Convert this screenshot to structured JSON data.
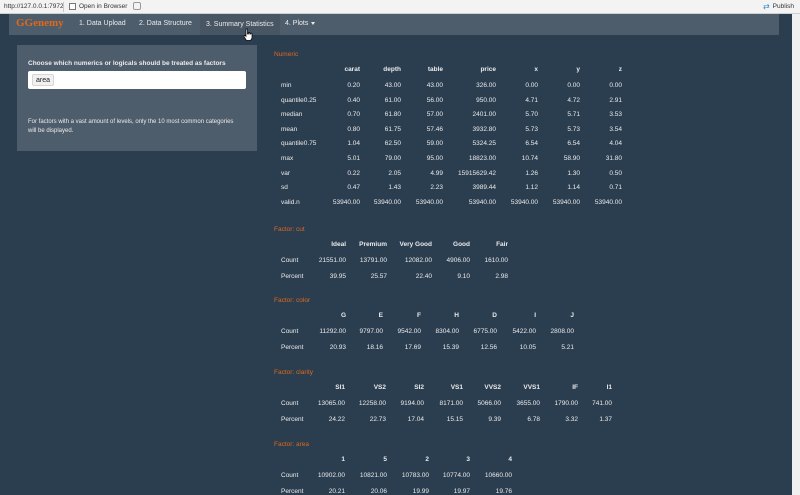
{
  "browser": {
    "url": "http://127.0.0.1:7972",
    "open_in_browser": "Open in Browser",
    "publish": "Publish"
  },
  "nav": {
    "brand": "GGenemy",
    "tabs": [
      {
        "label": "1. Data Upload"
      },
      {
        "label": "2. Data Structure"
      },
      {
        "label": "3. Summary Statistics",
        "active": true
      },
      {
        "label": "4. Plots"
      }
    ]
  },
  "sidebar": {
    "label": "Choose which numerics or logicals should be treated as factors",
    "selected": "area",
    "note": "For factors with a vast amount of levels, only the 10 most common categories will be displayed."
  },
  "numeric": {
    "title": "Numeric",
    "columns": [
      "carat",
      "depth",
      "table",
      "price",
      "x",
      "y",
      "z"
    ],
    "rows": [
      {
        "label": "min",
        "values": [
          "0.20",
          "43.00",
          "43.00",
          "326.00",
          "0.00",
          "0.00",
          "0.00"
        ]
      },
      {
        "label": "quantile0.25",
        "values": [
          "0.40",
          "61.00",
          "56.00",
          "950.00",
          "4.71",
          "4.72",
          "2.91"
        ]
      },
      {
        "label": "median",
        "values": [
          "0.70",
          "61.80",
          "57.00",
          "2401.00",
          "5.70",
          "5.71",
          "3.53"
        ]
      },
      {
        "label": "mean",
        "values": [
          "0.80",
          "61.75",
          "57.46",
          "3932.80",
          "5.73",
          "5.73",
          "3.54"
        ]
      },
      {
        "label": "quantile0.75",
        "values": [
          "1.04",
          "62.50",
          "59.00",
          "5324.25",
          "6.54",
          "6.54",
          "4.04"
        ]
      },
      {
        "label": "max",
        "values": [
          "5.01",
          "79.00",
          "95.00",
          "18823.00",
          "10.74",
          "58.90",
          "31.80"
        ]
      },
      {
        "label": "var",
        "values": [
          "0.22",
          "2.05",
          "4.99",
          "15915629.42",
          "1.26",
          "1.30",
          "0.50"
        ]
      },
      {
        "label": "sd",
        "values": [
          "0.47",
          "1.43",
          "2.23",
          "3989.44",
          "1.12",
          "1.14",
          "0.71"
        ]
      },
      {
        "label": "valid.n",
        "values": [
          "53940.00",
          "53940.00",
          "53940.00",
          "53940.00",
          "53940.00",
          "53940.00",
          "53940.00"
        ]
      }
    ]
  },
  "factors": [
    {
      "title": "Factor: cut",
      "columns": [
        "Ideal",
        "Premium",
        "Very Good",
        "Good",
        "Fair"
      ],
      "rows": [
        {
          "label": "Count",
          "values": [
            "21551.00",
            "13791.00",
            "12082.00",
            "4906.00",
            "1610.00"
          ]
        },
        {
          "label": "Percent",
          "values": [
            "39.95",
            "25.57",
            "22.40",
            "9.10",
            "2.98"
          ]
        }
      ]
    },
    {
      "title": "Factor: color",
      "columns": [
        "G",
        "E",
        "F",
        "H",
        "D",
        "I",
        "J"
      ],
      "rows": [
        {
          "label": "Count",
          "values": [
            "11292.00",
            "9797.00",
            "9542.00",
            "8304.00",
            "6775.00",
            "5422.00",
            "2808.00"
          ]
        },
        {
          "label": "Percent",
          "values": [
            "20.93",
            "18.16",
            "17.69",
            "15.39",
            "12.56",
            "10.05",
            "5.21"
          ]
        }
      ]
    },
    {
      "title": "Factor: clarity",
      "columns": [
        "SI1",
        "VS2",
        "SI2",
        "VS1",
        "VVS2",
        "VVS1",
        "IF",
        "I1"
      ],
      "rows": [
        {
          "label": "Count",
          "values": [
            "13065.00",
            "12258.00",
            "9194.00",
            "8171.00",
            "5066.00",
            "3655.00",
            "1790.00",
            "741.00"
          ]
        },
        {
          "label": "Percent",
          "values": [
            "24.22",
            "22.73",
            "17.04",
            "15.15",
            "9.39",
            "6.78",
            "3.32",
            "1.37"
          ]
        }
      ]
    },
    {
      "title": "Factor: area",
      "columns": [
        "1",
        "5",
        "2",
        "3",
        "4"
      ],
      "rows": [
        {
          "label": "Count",
          "values": [
            "10902.00",
            "10821.00",
            "10783.00",
            "10774.00",
            "10660.00"
          ]
        },
        {
          "label": "Percent",
          "values": [
            "20.21",
            "20.06",
            "19.99",
            "19.97",
            "19.76"
          ]
        }
      ]
    }
  ],
  "colors": {
    "background": "#2b3e50",
    "panel": "#4e5d6c",
    "accent": "#df691a",
    "text": "#ebebeb"
  }
}
